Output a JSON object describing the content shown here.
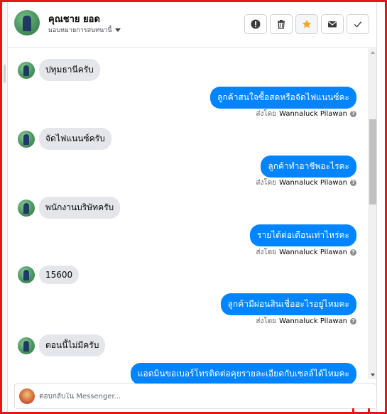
{
  "header": {
    "contact_name": "คุณชาย ยอด",
    "assign_label": "มอบหมายการสนทนานี้",
    "actions": [
      {
        "name": "mark-spam-button",
        "icon": "alert-icon"
      },
      {
        "name": "delete-button",
        "icon": "trash-icon"
      },
      {
        "name": "star-button",
        "icon": "star-icon"
      },
      {
        "name": "mark-unread-button",
        "icon": "envelope-icon"
      },
      {
        "name": "mark-done-button",
        "icon": "check-icon"
      }
    ]
  },
  "messages": {
    "m1": "ปทุมธานีครับ",
    "m2": "ลูกค้าสนใจซื้อสดหรือจัดไฟแนนซ์คะ",
    "m3": "จัดไฟแนนซ์ครับ",
    "m4": "ลูกค้าทำอาชีพอะไรคะ",
    "m5": "พนักงานบริษัทครับ",
    "m6": "รายได้ต่อเดือนเท่าไหร่คะ",
    "m7": "15600",
    "m8": "ลูกค้ามีผ่อนสินเชื่ออะไรอยู่ไหมคะ",
    "m9": "ตอนนี้ไม่มีครับ",
    "m10": "แอดมินขอเบอร์โทรติดต่อคุยรายละเอียดกับเซลล์ได้ไหมคะ"
  },
  "sent_by": {
    "prefix": "ส่งโดย",
    "agent": "Wannaluck Pilawan",
    "help": "?"
  },
  "composer": {
    "placeholder": "ตอบกลับใน Messenger..."
  },
  "colors": {
    "outgoing_bubble": "#0084ff",
    "incoming_bubble": "#e4e6eb",
    "star_accent": "#f5a623",
    "frame_border": "#e8141b"
  }
}
